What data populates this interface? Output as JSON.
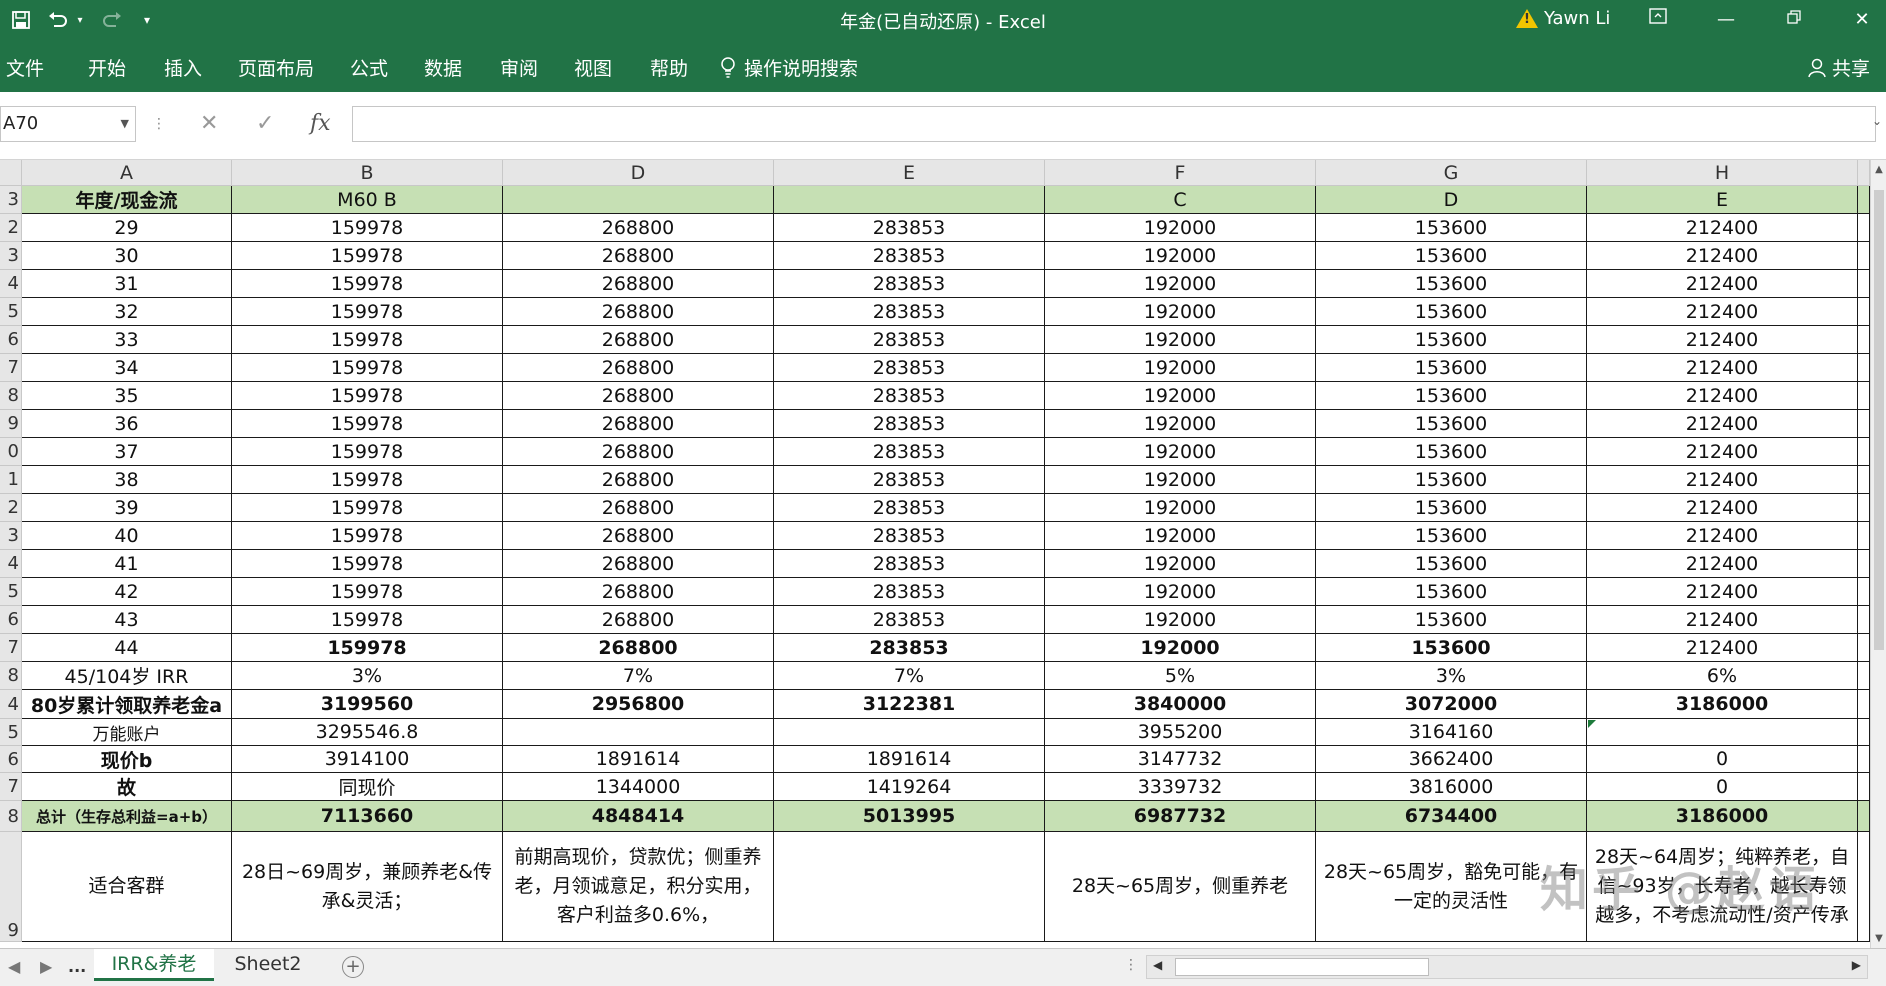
{
  "titlebar": {
    "title": "年金(已自动还原)  -  Excel",
    "user": "Yawn Li",
    "customize_label": "▾"
  },
  "ribbon": {
    "tabs": [
      "文件",
      "开始",
      "插入",
      "页面布局",
      "公式",
      "数据",
      "审阅",
      "视图",
      "帮助"
    ],
    "search_label": "操作说明搜索",
    "share_label": "共享"
  },
  "formula_bar": {
    "name_box": "A70",
    "formula": ""
  },
  "columns": [
    "A",
    "B",
    "D",
    "E",
    "F",
    "G",
    "H"
  ],
  "rows": [
    {
      "num": "3",
      "cells": [
        {
          "t": "年度/现金流",
          "c": "green b"
        },
        {
          "t": "M60 B",
          "c": "green"
        },
        {
          "t": "",
          "c": "green"
        },
        {
          "t": "",
          "c": "green"
        },
        {
          "t": "C",
          "c": "green"
        },
        {
          "t": "D",
          "c": "green"
        },
        {
          "t": "E",
          "c": "green"
        }
      ]
    },
    {
      "num": "2",
      "cells": [
        {
          "t": "29"
        },
        {
          "t": "159978"
        },
        {
          "t": "268800"
        },
        {
          "t": "283853"
        },
        {
          "t": "192000"
        },
        {
          "t": "153600"
        },
        {
          "t": "212400"
        }
      ]
    },
    {
      "num": "3",
      "cells": [
        {
          "t": "30"
        },
        {
          "t": "159978"
        },
        {
          "t": "268800"
        },
        {
          "t": "283853"
        },
        {
          "t": "192000"
        },
        {
          "t": "153600"
        },
        {
          "t": "212400"
        }
      ]
    },
    {
      "num": "4",
      "cells": [
        {
          "t": "31"
        },
        {
          "t": "159978"
        },
        {
          "t": "268800"
        },
        {
          "t": "283853"
        },
        {
          "t": "192000"
        },
        {
          "t": "153600"
        },
        {
          "t": "212400"
        }
      ]
    },
    {
      "num": "5",
      "cells": [
        {
          "t": "32"
        },
        {
          "t": "159978"
        },
        {
          "t": "268800"
        },
        {
          "t": "283853"
        },
        {
          "t": "192000"
        },
        {
          "t": "153600"
        },
        {
          "t": "212400"
        }
      ]
    },
    {
      "num": "6",
      "cells": [
        {
          "t": "33"
        },
        {
          "t": "159978"
        },
        {
          "t": "268800"
        },
        {
          "t": "283853"
        },
        {
          "t": "192000"
        },
        {
          "t": "153600"
        },
        {
          "t": "212400"
        }
      ]
    },
    {
      "num": "7",
      "cells": [
        {
          "t": "34"
        },
        {
          "t": "159978"
        },
        {
          "t": "268800"
        },
        {
          "t": "283853"
        },
        {
          "t": "192000"
        },
        {
          "t": "153600"
        },
        {
          "t": "212400"
        }
      ]
    },
    {
      "num": "8",
      "cells": [
        {
          "t": "35"
        },
        {
          "t": "159978"
        },
        {
          "t": "268800"
        },
        {
          "t": "283853"
        },
        {
          "t": "192000"
        },
        {
          "t": "153600"
        },
        {
          "t": "212400"
        }
      ]
    },
    {
      "num": "9",
      "cells": [
        {
          "t": "36"
        },
        {
          "t": "159978"
        },
        {
          "t": "268800"
        },
        {
          "t": "283853"
        },
        {
          "t": "192000"
        },
        {
          "t": "153600"
        },
        {
          "t": "212400"
        }
      ]
    },
    {
      "num": "0",
      "cells": [
        {
          "t": "37"
        },
        {
          "t": "159978"
        },
        {
          "t": "268800"
        },
        {
          "t": "283853"
        },
        {
          "t": "192000"
        },
        {
          "t": "153600"
        },
        {
          "t": "212400"
        }
      ]
    },
    {
      "num": "1",
      "cells": [
        {
          "t": "38"
        },
        {
          "t": "159978"
        },
        {
          "t": "268800"
        },
        {
          "t": "283853"
        },
        {
          "t": "192000"
        },
        {
          "t": "153600"
        },
        {
          "t": "212400"
        }
      ]
    },
    {
      "num": "2",
      "cells": [
        {
          "t": "39"
        },
        {
          "t": "159978"
        },
        {
          "t": "268800"
        },
        {
          "t": "283853"
        },
        {
          "t": "192000"
        },
        {
          "t": "153600"
        },
        {
          "t": "212400"
        }
      ]
    },
    {
      "num": "3",
      "cells": [
        {
          "t": "40"
        },
        {
          "t": "159978"
        },
        {
          "t": "268800"
        },
        {
          "t": "283853"
        },
        {
          "t": "192000"
        },
        {
          "t": "153600"
        },
        {
          "t": "212400"
        }
      ]
    },
    {
      "num": "4",
      "cells": [
        {
          "t": "41"
        },
        {
          "t": "159978"
        },
        {
          "t": "268800"
        },
        {
          "t": "283853"
        },
        {
          "t": "192000"
        },
        {
          "t": "153600"
        },
        {
          "t": "212400"
        }
      ]
    },
    {
      "num": "5",
      "cells": [
        {
          "t": "42"
        },
        {
          "t": "159978"
        },
        {
          "t": "268800"
        },
        {
          "t": "283853"
        },
        {
          "t": "192000"
        },
        {
          "t": "153600"
        },
        {
          "t": "212400"
        }
      ]
    },
    {
      "num": "6",
      "cells": [
        {
          "t": "43"
        },
        {
          "t": "159978"
        },
        {
          "t": "268800"
        },
        {
          "t": "283853"
        },
        {
          "t": "192000"
        },
        {
          "t": "153600"
        },
        {
          "t": "212400"
        }
      ]
    },
    {
      "num": "7",
      "cells": [
        {
          "t": "44"
        },
        {
          "t": "159978",
          "c": "b"
        },
        {
          "t": "268800",
          "c": "b"
        },
        {
          "t": "283853",
          "c": "b"
        },
        {
          "t": "192000",
          "c": "b"
        },
        {
          "t": "153600",
          "c": "b"
        },
        {
          "t": "212400"
        }
      ]
    },
    {
      "num": "8",
      "cells": [
        {
          "t": "45/104岁 IRR"
        },
        {
          "t": "3%"
        },
        {
          "t": "7%"
        },
        {
          "t": "7%"
        },
        {
          "t": "5%"
        },
        {
          "t": "3%"
        },
        {
          "t": "6%"
        }
      ]
    },
    {
      "num": "4",
      "cells": [
        {
          "t": "80岁累计领取养老金a",
          "c": "b"
        },
        {
          "t": "3199560",
          "c": "b"
        },
        {
          "t": "2956800",
          "c": "b"
        },
        {
          "t": "3122381",
          "c": "b"
        },
        {
          "t": "3840000",
          "c": "b"
        },
        {
          "t": "3072000",
          "c": "b"
        },
        {
          "t": "3186000",
          "c": "b"
        }
      ]
    },
    {
      "num": "5",
      "cells": [
        {
          "t": "万能账户"
        },
        {
          "t": "3295546.8"
        },
        {
          "t": ""
        },
        {
          "t": ""
        },
        {
          "t": "3955200"
        },
        {
          "t": "3164160"
        },
        {
          "t": ""
        }
      ]
    },
    {
      "num": "6",
      "cells": [
        {
          "t": "现价b",
          "c": "b"
        },
        {
          "t": "3914100"
        },
        {
          "t": "1891614"
        },
        {
          "t": "1891614"
        },
        {
          "t": "3147732"
        },
        {
          "t": "3662400"
        },
        {
          "t": "0"
        }
      ]
    },
    {
      "num": "7",
      "cells": [
        {
          "t": "故",
          "c": "b"
        },
        {
          "t": "同现价"
        },
        {
          "t": "1344000"
        },
        {
          "t": "1419264"
        },
        {
          "t": "3339732"
        },
        {
          "t": "3816000"
        },
        {
          "t": "0"
        }
      ]
    },
    {
      "num": "8",
      "cells": [
        {
          "t": "总计（生存总利益=a+b）",
          "c": "green b"
        },
        {
          "t": "7113660",
          "c": "green b"
        },
        {
          "t": "4848414",
          "c": "green b"
        },
        {
          "t": "5013995",
          "c": "green b"
        },
        {
          "t": "6987732",
          "c": "green b"
        },
        {
          "t": "6734400",
          "c": "green b"
        },
        {
          "t": "3186000",
          "c": "green b"
        }
      ]
    },
    {
      "num": "9",
      "cells": [
        {
          "t": "适合客群",
          "c": "wrap"
        },
        {
          "t": "28日~69周岁，兼顾养老&传承&灵活；",
          "c": "wrap"
        },
        {
          "t": "前期高现价，贷款优；侧重养老，月领诚意足，积分实用，客户利益多0.6%，",
          "c": "wrap"
        },
        {
          "t": "",
          "c": "wrap"
        },
        {
          "t": "28天~65周岁，侧重养老",
          "c": "wrap"
        },
        {
          "t": "28天~65周岁，豁免可能，有一定的灵活性",
          "c": "wrap"
        },
        {
          "t": "28天~64周岁；纯粹养老，自信~93岁，长寿者，越长寿领越多，不考虑流动性/资产传承",
          "c": "wrap"
        }
      ]
    }
  ],
  "sheets": {
    "more": "...",
    "tabs": [
      "IRR&养老",
      "Sheet2"
    ],
    "active": 0
  },
  "watermark": "知乎 @赵语"
}
